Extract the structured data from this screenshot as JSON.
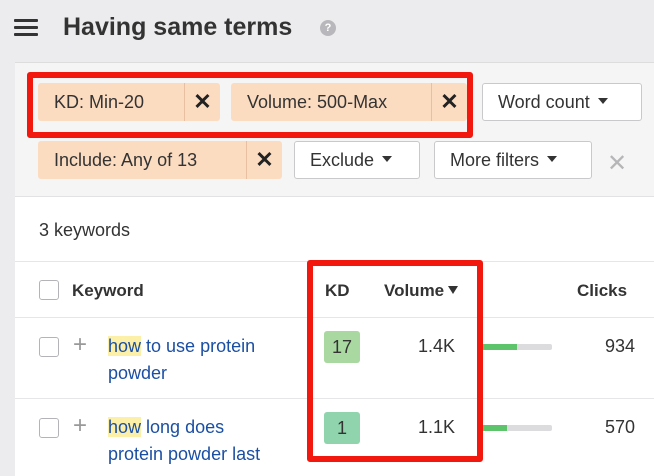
{
  "header": {
    "title": "Having same terms",
    "help_glyph": "?"
  },
  "filters": {
    "chips": [
      {
        "label": "KD: Min-20",
        "remove": "✕"
      },
      {
        "label": "Volume: 500-Max",
        "remove": "✕"
      },
      {
        "label": "Include: Any of 13",
        "remove": "✕"
      }
    ],
    "buttons": {
      "word_count": "Word count",
      "exclude": "Exclude",
      "more_filters": "More filters"
    },
    "clear": "✕"
  },
  "summary": {
    "keyword_count": "3 keywords"
  },
  "table": {
    "headers": {
      "keyword": "Keyword",
      "kd": "KD",
      "volume": "Volume",
      "clicks": "Clicks"
    },
    "rows": [
      {
        "highlight": "how",
        "rest_line1": " to use protein",
        "line2": "powder",
        "kd": "17",
        "kd_color": "#a9d8a0",
        "volume": "1.4K",
        "volume_bar_fraction": 0.5,
        "clicks": "934"
      },
      {
        "highlight": "how",
        "rest_line1": " long does",
        "line2": "protein powder last",
        "kd": "1",
        "kd_color": "#8fd4ad",
        "volume": "1.1K",
        "volume_bar_fraction": 0.35,
        "clicks": "570"
      }
    ]
  },
  "colors": {
    "accent_red": "#f2180e",
    "chip_bg": "#fcdcc0",
    "link": "#1b4fa3",
    "highlight": "#fcf0a8",
    "bar_fill": "#5ec46b"
  }
}
